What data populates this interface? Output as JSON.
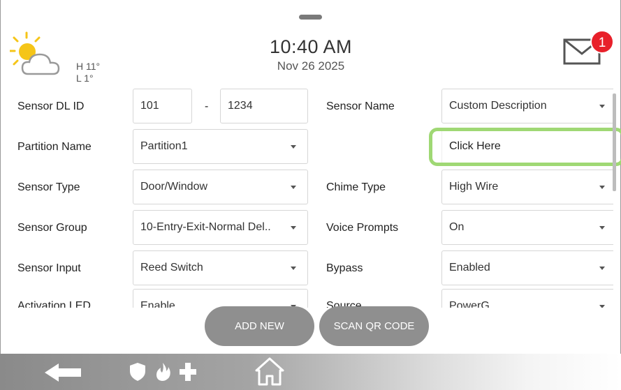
{
  "weather": {
    "icon": "partly-cloudy-icon",
    "high": "H 11°",
    "low": "L 1°"
  },
  "clock": {
    "time": "10:40 AM",
    "date": "Nov 26 2025"
  },
  "messages": {
    "icon": "envelope-icon",
    "count": "1"
  },
  "form": {
    "sensor_dl_id": {
      "label": "Sensor DL ID",
      "part1": "101",
      "separator": "-",
      "part2": "1234"
    },
    "sensor_name": {
      "label": "Sensor Name",
      "value": "Custom Description"
    },
    "custom_description": {
      "value": "Click Here"
    },
    "partition_name": {
      "label": "Partition Name",
      "value": "Partition1"
    },
    "sensor_type": {
      "label": "Sensor Type",
      "value": "Door/Window"
    },
    "chime_type": {
      "label": "Chime Type",
      "value": "High Wire"
    },
    "sensor_group": {
      "label": "Sensor Group",
      "value": "10-Entry-Exit-Normal Del.."
    },
    "voice_prompts": {
      "label": "Voice Prompts",
      "value": "On"
    },
    "sensor_input": {
      "label": "Sensor Input",
      "value": "Reed Switch"
    },
    "bypass": {
      "label": "Bypass",
      "value": "Enabled"
    },
    "activation_led": {
      "label": "Activation LED",
      "value": "Enable"
    },
    "source": {
      "label": "Source",
      "value": "PowerG"
    }
  },
  "actions": {
    "add_new": "ADD NEW",
    "scan_qr": "SCAN QR CODE"
  },
  "colors": {
    "highlight": "#9fd874",
    "badge": "#e8202a",
    "button": "#8f8f8f"
  },
  "navbar": {
    "icons": [
      "back-arrow-icon",
      "shield-icon",
      "fire-icon",
      "medical-cross-icon",
      "home-icon"
    ]
  }
}
